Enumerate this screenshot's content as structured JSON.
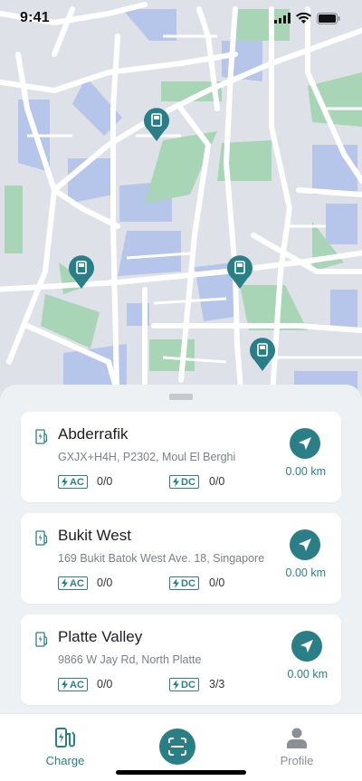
{
  "status_bar": {
    "time": "9:41"
  },
  "colors": {
    "accent": "#2a7f87",
    "map_green": "#a8d5b5",
    "map_blue": "#b6c6ea",
    "map_gray": "#dfe1e8"
  },
  "stations": [
    {
      "name": "Abderrafik",
      "address": "GXJX+H4H, P2302, Moul El Berghi",
      "ac_label": "AC",
      "ac_count": "0/0",
      "dc_label": "DC",
      "dc_count": "0/0",
      "distance": "0.00 km"
    },
    {
      "name": "Bukit West",
      "address": "169 Bukit Batok West Ave. 18, Singapore",
      "ac_label": "AC",
      "ac_count": "0/0",
      "dc_label": "DC",
      "dc_count": "0/0",
      "distance": "0.00 km"
    },
    {
      "name": "Platte Valley",
      "address": "9866 W Jay Rd, North Platte",
      "ac_label": "AC",
      "ac_count": "0/0",
      "dc_label": "DC",
      "dc_count": "3/3",
      "distance": "0.00 km"
    }
  ],
  "tabbar": {
    "charge_label": "Charge",
    "profile_label": "Profile"
  },
  "icons": [
    "signal-icon",
    "wifi-icon",
    "battery-icon",
    "charging-station-pin-icon",
    "ev-station-icon",
    "bolt-icon",
    "navigate-icon",
    "charge-tab-icon",
    "scan-icon",
    "profile-icon"
  ]
}
